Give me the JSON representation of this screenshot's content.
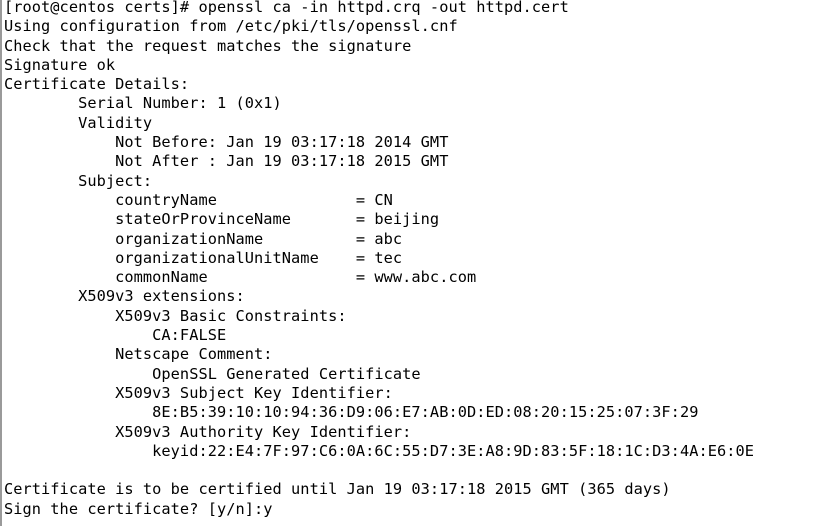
{
  "terminal": {
    "shell_prompt": "[root@centos certs]#",
    "command": "openssl ca -in httpd.crq -out httpd.cert",
    "colors": {
      "background": "#ffffff",
      "foreground": "#000000",
      "gutter_rule": "#9a9a9a"
    },
    "lines": [
      "[root@centos certs]# openssl ca -in httpd.crq -out httpd.cert",
      "Using configuration from /etc/pki/tls/openssl.cnf",
      "Check that the request matches the signature",
      "Signature ok",
      "Certificate Details:",
      "        Serial Number: 1 (0x1)",
      "        Validity",
      "            Not Before: Jan 19 03:17:18 2014 GMT",
      "            Not After : Jan 19 03:17:18 2015 GMT",
      "        Subject:",
      "            countryName               = CN",
      "            stateOrProvinceName       = beijing",
      "            organizationName          = abc",
      "            organizationalUnitName    = tec",
      "            commonName                = www.abc.com",
      "        X509v3 extensions:",
      "            X509v3 Basic Constraints:",
      "                CA:FALSE",
      "            Netscape Comment:",
      "                OpenSSL Generated Certificate",
      "            X509v3 Subject Key Identifier:",
      "                8E:B5:39:10:10:94:36:D9:06:E7:AB:0D:ED:08:20:15:25:07:3F:29",
      "            X509v3 Authority Key Identifier:",
      "                keyid:22:E4:7F:97:C6:0A:6C:55:D7:3E:A8:9D:83:5F:18:1C:D3:4A:E6:0E",
      "",
      "Certificate is to be certified until Jan 19 03:17:18 2015 GMT (365 days)",
      "Sign the certificate? [y/n]:y"
    ],
    "certificate": {
      "config_file": "/etc/pki/tls/openssl.cnf",
      "signature_status": "Signature ok",
      "details_header": "Certificate Details:",
      "serial_number_label": "Serial Number:",
      "serial_number_value": "1 (0x1)",
      "validity_label": "Validity",
      "not_before_label": "Not Before:",
      "not_before_value": "Jan 19 03:17:18 2014 GMT",
      "not_after_label": "Not After :",
      "not_after_value": "Jan 19 03:17:18 2015 GMT",
      "subject_label": "Subject:",
      "subject_fields": [
        {
          "name": "countryName",
          "value": "CN"
        },
        {
          "name": "stateOrProvinceName",
          "value": "beijing"
        },
        {
          "name": "organizationName",
          "value": "abc"
        },
        {
          "name": "organizationalUnitName",
          "value": "tec"
        },
        {
          "name": "commonName",
          "value": "www.abc.com"
        }
      ],
      "extensions_label": "X509v3 extensions:",
      "extensions": [
        {
          "name": "X509v3 Basic Constraints:",
          "value": "CA:FALSE"
        },
        {
          "name": "Netscape Comment:",
          "value": "OpenSSL Generated Certificate"
        },
        {
          "name": "X509v3 Subject Key Identifier:",
          "value": "8E:B5:39:10:10:94:36:D9:06:E7:AB:0D:ED:08:20:15:25:07:3F:29"
        },
        {
          "name": "X509v3 Authority Key Identifier:",
          "value": "keyid:22:E4:7F:97:C6:0A:6C:55:D7:3E:A8:9D:83:5F:18:1C:D3:4A:E6:0E"
        }
      ],
      "certified_until_message": "Certificate is to be certified until Jan 19 03:17:18 2015 GMT (365 days)",
      "sign_prompt": "Sign the certificate? [y/n]:",
      "sign_answer": "y"
    }
  }
}
